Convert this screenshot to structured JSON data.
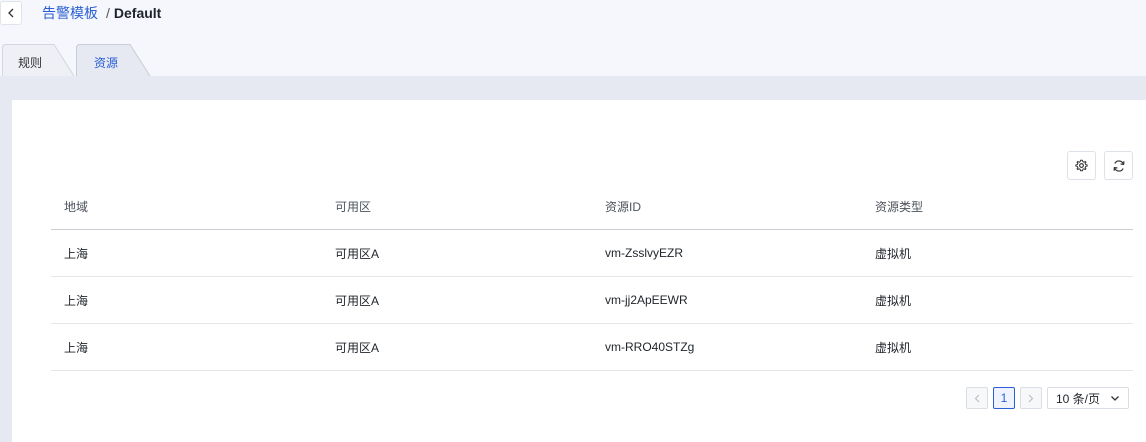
{
  "breadcrumb": {
    "parent": "告警模板",
    "separator": "/",
    "current": "Default"
  },
  "tabs": [
    {
      "label": "规则",
      "active": false
    },
    {
      "label": "资源",
      "active": true
    }
  ],
  "toolbar": {
    "settings_icon": "gear-icon",
    "refresh_icon": "refresh-icon"
  },
  "table": {
    "columns": [
      "地域",
      "可用区",
      "资源ID",
      "资源类型"
    ],
    "rows": [
      {
        "region": "上海",
        "zone": "可用区A",
        "resource_id": "vm-ZsslvyEZR",
        "type": "虚拟机"
      },
      {
        "region": "上海",
        "zone": "可用区A",
        "resource_id": "vm-jj2ApEEWR",
        "type": "虚拟机"
      },
      {
        "region": "上海",
        "zone": "可用区A",
        "resource_id": "vm-RRO40STZg",
        "type": "虚拟机"
      }
    ]
  },
  "pagination": {
    "current_page": "1",
    "page_size": "10 条/页"
  },
  "colors": {
    "accent": "#2a5fd3",
    "header_bg": "#f5f7fc",
    "band_bg": "#e6e8f2"
  }
}
